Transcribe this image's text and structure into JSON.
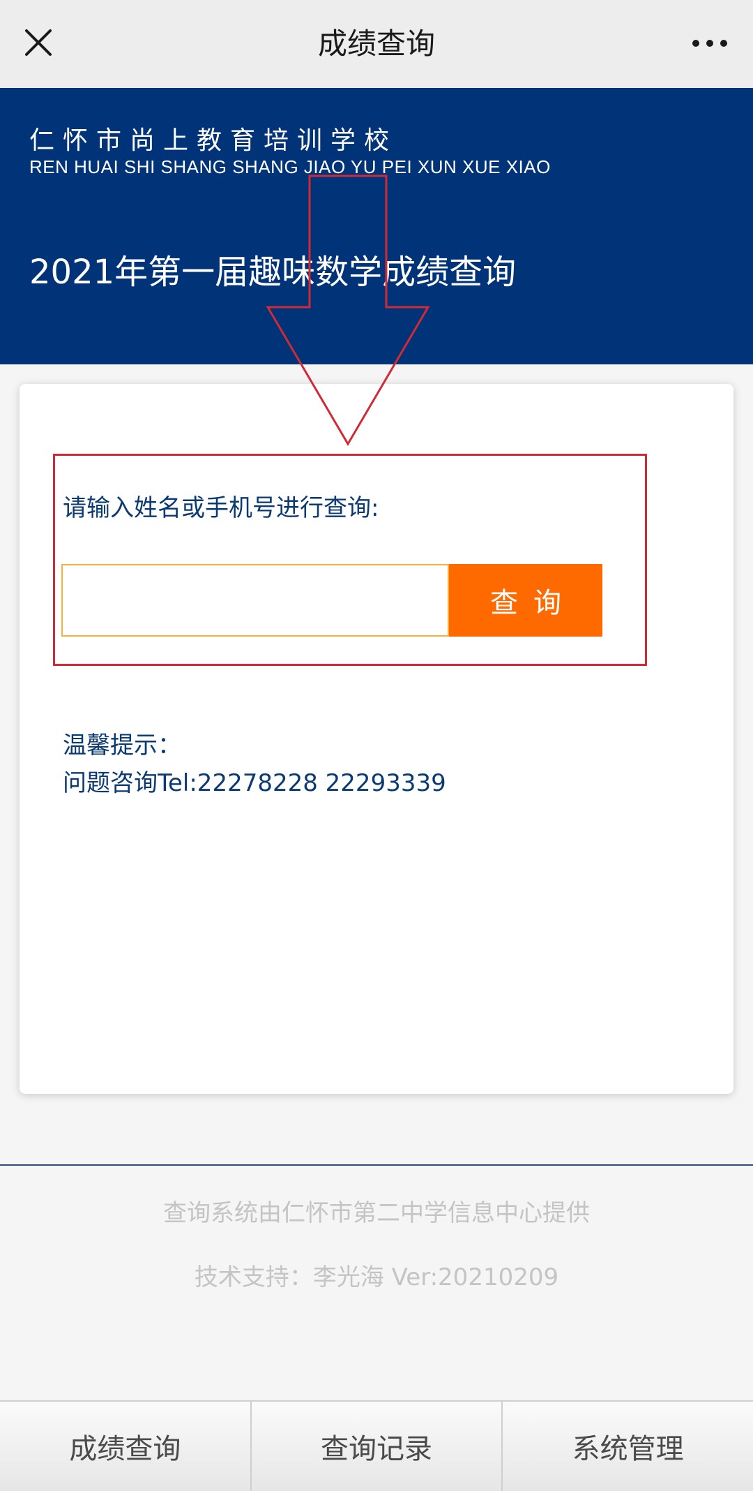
{
  "topbar": {
    "title": "成绩查询",
    "close_icon": "close-icon",
    "more_icon": "more-icon"
  },
  "banner": {
    "school_name": "仁怀市尚上教育培训学校",
    "school_pinyin": "REN HUAI SHI SHANG SHANG JIAO YU PEI XUN XUE XIAO",
    "heading": "2021年第一届趣味数学成绩查询"
  },
  "query": {
    "prompt": "请输入姓名或手机号进行查询:",
    "input_value": "",
    "button_label": "查询"
  },
  "tips": {
    "title": "温馨提示：",
    "tel": "问题咨询Tel:22278228 22293339"
  },
  "footer": {
    "line1": "查询系统由仁怀市第二中学信息中心提供",
    "line2": "技术支持：李光海  Ver:20210209"
  },
  "bottom_nav": {
    "items": [
      {
        "label": "成绩查询"
      },
      {
        "label": "查询记录"
      },
      {
        "label": "系统管理"
      }
    ]
  },
  "colors": {
    "banner_bg": "#003378",
    "button_bg": "#ff6a00",
    "annotation_red": "#d02a36",
    "text_blue": "#0b3a73"
  }
}
